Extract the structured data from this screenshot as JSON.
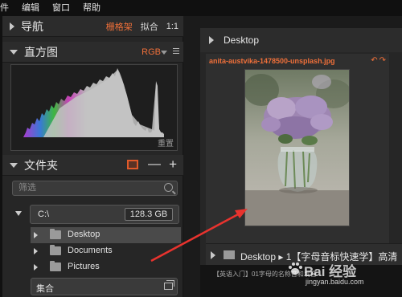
{
  "menubar": {
    "items": [
      "件",
      "编辑",
      "窗口",
      "帮助"
    ]
  },
  "navigator": {
    "title": "导航",
    "options": [
      "栅格架",
      "拟合",
      "1:1"
    ]
  },
  "histogram": {
    "title": "直方图",
    "channel": "RGB",
    "reset_label": "重置"
  },
  "folders": {
    "title": "文件夹",
    "filter_placeholder": "筛选",
    "drive": {
      "label": "C:\\",
      "size": "128.3 GB"
    },
    "items": [
      {
        "label": "Desktop",
        "selected": true
      },
      {
        "label": "Documents",
        "selected": false
      },
      {
        "label": "Pictures",
        "selected": false
      }
    ],
    "collections_label": "集合"
  },
  "browser": {
    "title": "Desktop",
    "thumbnail": {
      "filename": "anita-austvika-1478500-unsplash.jpg",
      "rating_stars": "☆☆☆☆☆"
    },
    "footer_path": "Desktop ▸ 1【字母音标快速学】高清"
  },
  "bottom_text": "【英语入门】01字母的名称音和发音",
  "watermark": {
    "line1": "Bai 经验",
    "line2": "jingyan.baidu.com"
  },
  "colors": {
    "accent": "#f0703a",
    "arrow": "#e8332e"
  }
}
